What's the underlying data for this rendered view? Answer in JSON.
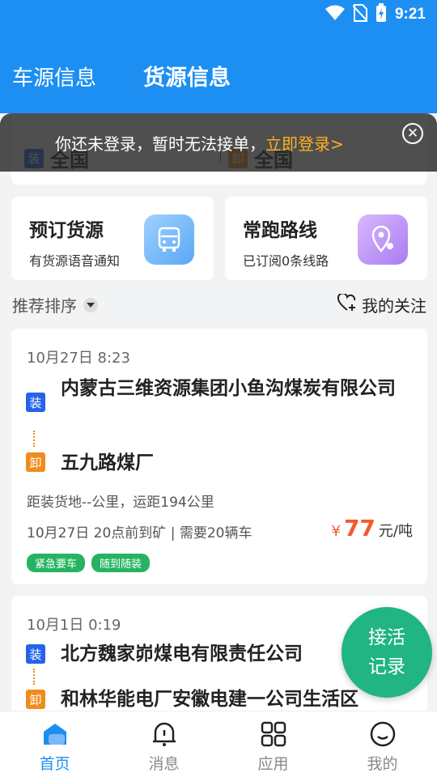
{
  "status_bar": {
    "time": "9:21"
  },
  "header": {
    "tabs": [
      {
        "label": "车源信息",
        "active": false
      },
      {
        "label": "货源信息",
        "active": true
      }
    ]
  },
  "route": {
    "load_tag": "装",
    "load_text": "全国",
    "unload_tag": "卸",
    "unload_text": "全国"
  },
  "login_banner": {
    "text": "你还未登录，暂时无法接单，",
    "link": "立即登录>"
  },
  "features": [
    {
      "title": "预订货源",
      "subtitle": "有货源语音通知",
      "icon": "truck-icon"
    },
    {
      "title": "常跑路线",
      "subtitle": "已订阅0条线路",
      "icon": "location-icon"
    }
  ],
  "sort": {
    "label": "推荐排序",
    "follow_label": "我的关注"
  },
  "jobs": [
    {
      "time": "10月27日 8:23",
      "load_tag": "装",
      "load": "内蒙古三维资源集团小鱼沟煤炭有限公司",
      "unload_tag": "卸",
      "unload": "五九路煤厂",
      "distance": "距装货地--公里，运距194公里",
      "meta": "10月27日 20点前到矿 | 需要20辆车",
      "price_symbol": "¥",
      "price": "77",
      "price_unit": "元/吨",
      "badges": [
        "紧急要车",
        "随到随装"
      ]
    },
    {
      "time": "10月1日 0:19",
      "load_tag": "装",
      "load": "北方魏家峁煤电有限责任公司",
      "unload_tag": "卸",
      "unload": "和林华能电厂安徽电建一公司生活区"
    }
  ],
  "fab": {
    "line1": "接活",
    "line2": "记录"
  },
  "bottom_nav": [
    {
      "label": "首页",
      "icon": "home-icon",
      "active": true
    },
    {
      "label": "消息",
      "icon": "bell-icon",
      "active": false
    },
    {
      "label": "应用",
      "icon": "apps-icon",
      "active": false
    },
    {
      "label": "我的",
      "icon": "profile-icon",
      "active": false
    }
  ],
  "colors": {
    "primary": "#1e8ff2",
    "price": "#f25a2d",
    "badge": "#25b462",
    "fab": "#20b583",
    "login_link": "#ffb01f"
  }
}
